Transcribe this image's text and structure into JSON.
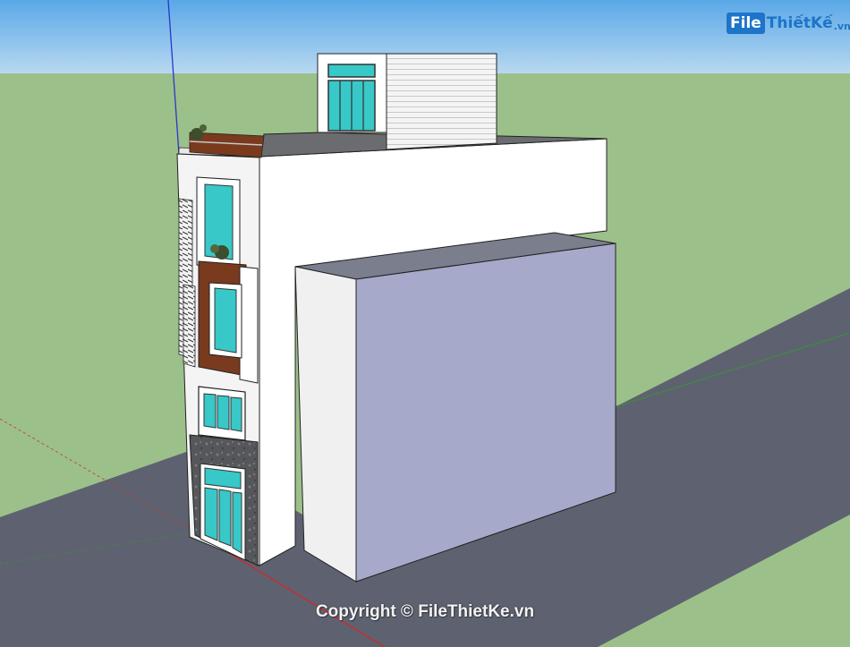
{
  "watermark": {
    "logo_box": "File",
    "logo_main": "ThiếtKế",
    "logo_tld": ".vn",
    "copyright": "Copyright © FileThietKe.vn"
  },
  "colors": {
    "sky": "#7fb9ea",
    "ground": "#9cc08a",
    "road": "#5e6270",
    "wall": "#ffffff",
    "annex_face": "#a6a9c9",
    "glass": "#38c8c8",
    "wood": "#7a3a1e",
    "stone": "#55575a"
  }
}
